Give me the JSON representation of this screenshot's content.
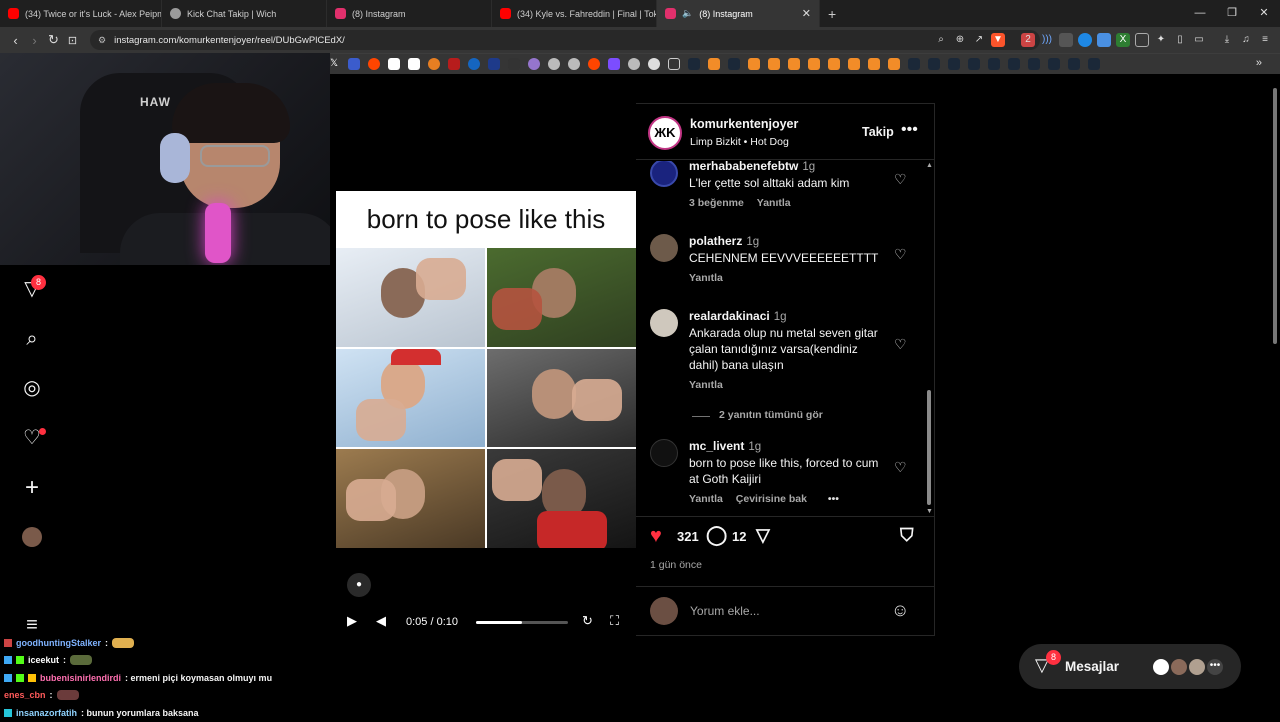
{
  "browser": {
    "tabs": [
      {
        "title": "(34) Twice or it's Luck - Alex Peipman",
        "icon": "youtube-icon",
        "color": "#ff0000",
        "active": false
      },
      {
        "title": "Kick Chat Takip | Wich",
        "icon": "globe-icon",
        "color": "#9a9a9a",
        "active": false
      },
      {
        "title": "(8) Instagram",
        "icon": "instagram-icon",
        "color": "#e1306c",
        "active": false
      },
      {
        "title": "(34) Kyle vs. Fahreddin | Final | Tokyo",
        "icon": "youtube-icon",
        "color": "#ff0000",
        "active": false
      },
      {
        "title": "(8) Instagram",
        "icon": "instagram-icon",
        "color": "#e1306c",
        "active": true
      }
    ],
    "new_tab": "+",
    "url": "instagram.com/komurkentenjoyer/reel/DUbGwPlCEdX/"
  },
  "instagram": {
    "sidebar_badge": "8",
    "reel": {
      "caption": "born to pose like this",
      "time": "0:05 / 0:10",
      "progress": 0.5
    },
    "post": {
      "username": "komurkentenjoyer",
      "audio": "Limp Bizkit • Hot Dog",
      "logo_text": "ЖK",
      "follow": "Takip",
      "likes": "321",
      "comments_count": "12",
      "date": "1 gün önce",
      "add_comment_placeholder": "Yorum ekle..."
    },
    "comments": [
      {
        "user": "merhababenefebtw",
        "time": "1g",
        "text": "L'ler çette sol alttaki adam kim",
        "likes": "3 beğenme",
        "reply": "Yanıtla"
      },
      {
        "user": "polatherz",
        "time": "1g",
        "text": "CEHENNEM EEVVVEEEEEETTTT",
        "reply": "Yanıtla"
      },
      {
        "user": "realardakinaci",
        "time": "1g",
        "text": "Ankarada olup nu metal seven gitar çalan tanıdığınız varsa(kendiniz dahil) bana ulaşın",
        "reply": "Yanıtla"
      },
      {
        "user": "mc_livent",
        "time": "1g",
        "text": "born to pose like this, forced to cum at Goth Kaijiri",
        "reply": "Yanıtla",
        "translate": "Çevirisine bak"
      }
    ],
    "view_replies": "2 yanıtın tümünü gör",
    "messages": {
      "label": "Mesajlar",
      "badge": "8"
    }
  },
  "stream_chat": [
    {
      "user": "goodhuntingStalker",
      "color": "#7fb3ff",
      "message": ":"
    },
    {
      "user": "iceekut",
      "color": "#ffffff",
      "message": ":"
    },
    {
      "user": "bubenisinirlendirdi",
      "color": "#ff6fb0",
      "message": ": ermeni piçi koymasan olmuyı mu"
    },
    {
      "user": "enes_cbn",
      "color": "#ff5a5a",
      "message": ":"
    },
    {
      "user": "insanazorfatih",
      "color": "#8fd3ff",
      "message": ": bunun yorumlara baksana"
    }
  ],
  "webcam": {
    "chair_brand": "HAW"
  }
}
